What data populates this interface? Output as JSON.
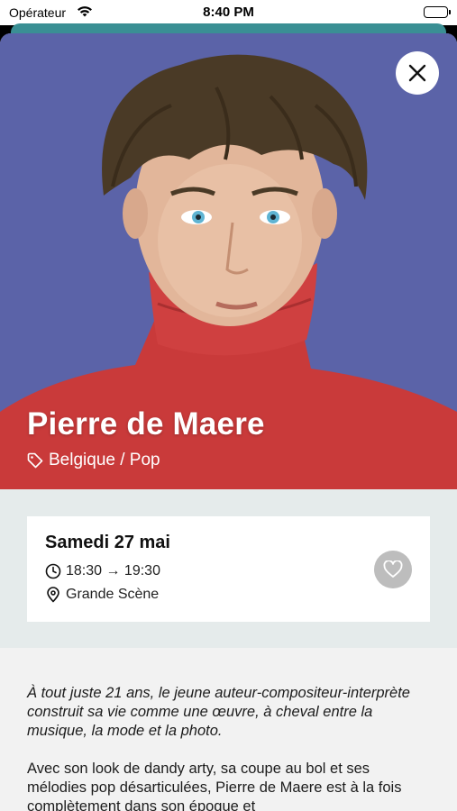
{
  "status_bar": {
    "carrier": "Opérateur",
    "time": "8:40 PM"
  },
  "artist": {
    "name": "Pierre de Maere",
    "tags": "Belgique / Pop"
  },
  "schedule": {
    "date": "Samedi 27 mai",
    "time": "18:30 → 19:30",
    "stage": "Grande Scène"
  },
  "description": {
    "intro": "À tout juste 21 ans, le jeune auteur-compositeur-interprète construit sa vie comme une œuvre, à cheval entre la musique, la mode et la photo.",
    "body": "Avec son look de dandy arty, sa coupe au bol et ses mélodies pop désarticulées, Pierre de Maere est à la fois complètement dans son époque et"
  },
  "colors": {
    "hero_background": "#5b63a8",
    "sweater_red": "#c93a3a",
    "schedule_background": "#e5ebeb",
    "favorite_button": "#bdbdbd",
    "underlying_sheet": "#3a8f94"
  },
  "icons": {
    "close": "close-icon",
    "tag": "tag-icon",
    "clock": "clock-icon",
    "location": "location-pin-icon",
    "favorite": "heart-icon",
    "wifi": "wifi-icon",
    "battery": "battery-icon"
  }
}
